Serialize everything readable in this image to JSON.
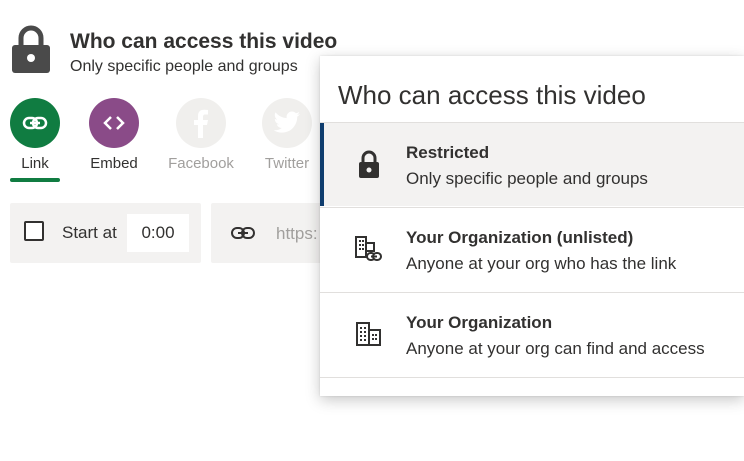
{
  "header": {
    "title": "Who can access this video",
    "subtitle": "Only specific people and groups",
    "icon": "lock-icon"
  },
  "share_targets": [
    {
      "label": "Link",
      "icon": "link-icon",
      "color": "#107c41"
    },
    {
      "label": "Embed",
      "icon": "embed-code-icon",
      "color": "#8a4b88"
    },
    {
      "label": "Facebook",
      "icon": "facebook-icon",
      "color": "#f0efed"
    },
    {
      "label": "Twitter",
      "icon": "twitter-icon",
      "color": "#f0efed"
    }
  ],
  "start_at": {
    "label": "Start at",
    "checked": false,
    "value": "0:00"
  },
  "url_field": {
    "text": "https:"
  },
  "access_dropdown": {
    "title": "Who can access this video",
    "options": [
      {
        "title": "Restricted",
        "description": "Only specific people and groups",
        "icon": "lock-icon",
        "selected": true
      },
      {
        "title": "Your Organization (unlisted)",
        "description": "Anyone at your org who has the link",
        "icon": "building-link-icon",
        "selected": false
      },
      {
        "title": "Your Organization",
        "description": "Anyone at your org can find and access",
        "icon": "building-icon",
        "selected": false
      }
    ]
  },
  "colors": {
    "accent_green": "#107c41",
    "embed_purple": "#8a4b88",
    "selected_bar": "#0f3d6e"
  }
}
